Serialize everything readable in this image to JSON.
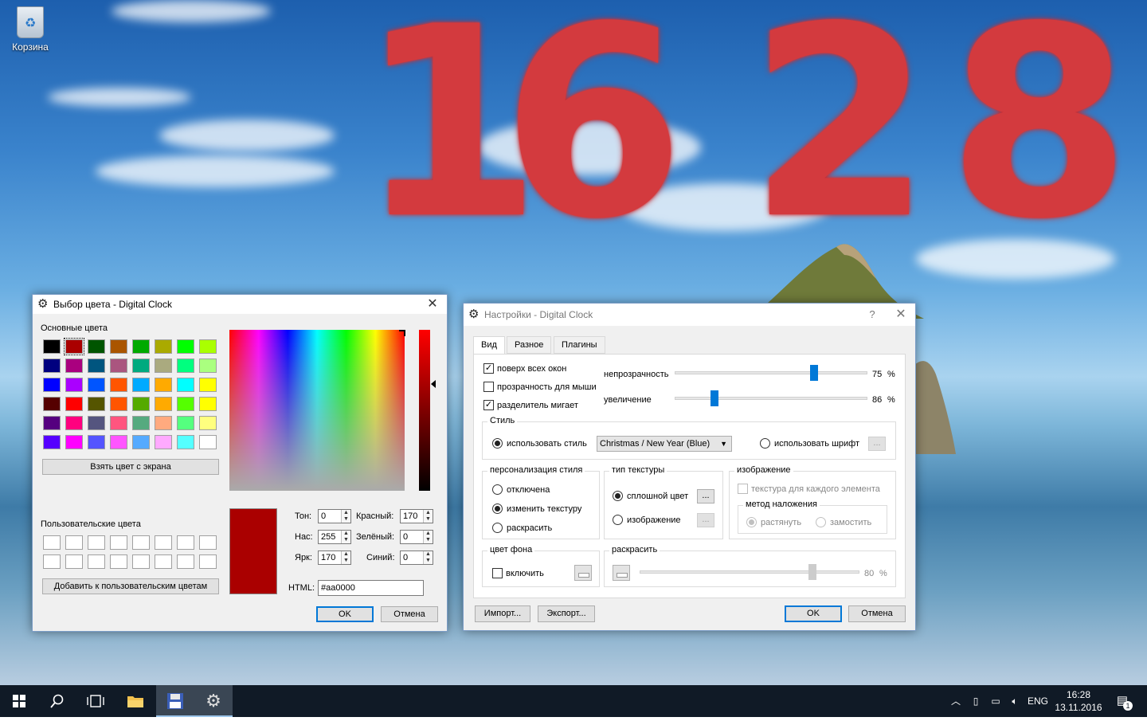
{
  "desktop": {
    "clock_digits": [
      "1",
      "6",
      "2",
      "8"
    ],
    "recycle_bin_label": "Корзина"
  },
  "color_dialog": {
    "title": "Выбор цвета - Digital Clock",
    "basic_colors_label": "Основные цвета",
    "basic_colors": [
      "#000000",
      "#aa0000",
      "#005500",
      "#aa5500",
      "#00aa00",
      "#aaaa00",
      "#00ff00",
      "#aaff00",
      "#00007f",
      "#aa007f",
      "#00557f",
      "#aa557f",
      "#00aa7f",
      "#aaaa7f",
      "#00ff7f",
      "#aaff7f",
      "#0000ff",
      "#aa00ff",
      "#0055ff",
      "#ff5500",
      "#00aaff",
      "#ffaa00",
      "#00ffff",
      "#ffff00",
      "#550000",
      "#ff0000",
      "#555500",
      "#ff5500",
      "#55aa00",
      "#ffaa00",
      "#55ff00",
      "#ffff00",
      "#55007f",
      "#ff007f",
      "#55557f",
      "#ff557f",
      "#55aa7f",
      "#ffaa7f",
      "#55ff7f",
      "#ffff7f",
      "#5500ff",
      "#ff00ff",
      "#5555ff",
      "#ff55ff",
      "#55aaff",
      "#ffaaff",
      "#55ffff",
      "#ffffff"
    ],
    "pick_screen_button": "Взять цвет с экрана",
    "custom_colors_label": "Пользовательские цвета",
    "add_custom_button": "Добавить к пользовательским цветам",
    "current_color": "#aa0000",
    "hue_label": "Тон:",
    "hue_value": "0",
    "sat_label": "Нас:",
    "sat_value": "255",
    "val_label": "Ярк:",
    "val_value": "170",
    "red_label": "Красный:",
    "red_value": "170",
    "green_label": "Зелёный:",
    "green_value": "0",
    "blue_label": "Синий:",
    "blue_value": "0",
    "html_label": "HTML:",
    "html_value": "#aa0000",
    "ok_button": "OK",
    "cancel_button": "Отмена"
  },
  "settings_dialog": {
    "title": "Настройки - Digital Clock",
    "help_glyph": "?",
    "tabs": [
      "Вид",
      "Разное",
      "Плагины"
    ],
    "stay_on_top": "поверх всех окон",
    "mouse_transparent": "прозрачность для мыши",
    "separator_blink": "разделитель мигает",
    "opacity_label": "непрозрачность",
    "opacity_value": "75",
    "zoom_label": "увеличение",
    "zoom_value": "86",
    "percent": "%",
    "style_group": "Стиль",
    "use_style": "использовать стиль",
    "style_selected": "Christmas / New Year (Blue)",
    "use_font": "использовать шрифт",
    "dots": "...",
    "personalize_group": "персонализация стиля",
    "opt_disabled": "отключена",
    "opt_change_texture": "изменить текстуру",
    "opt_colorize": "раскрасить",
    "texture_type_group": "тип текстуры",
    "solid_color": "сплошной цвет",
    "image_option": "изображение",
    "image_group": "изображение",
    "texture_per_element": "текстура для каждого элемента",
    "placement_group": "метод наложения",
    "stretch": "растянуть",
    "tile": "замостить",
    "background_group": "цвет фона",
    "enable": "включить",
    "colorize_group": "раскрасить",
    "colorize_value": "80",
    "import_button": "Импорт...",
    "export_button": "Экспорт...",
    "ok_button": "OK",
    "cancel_button": "Отмена"
  },
  "taskbar": {
    "language": "ENG",
    "time": "16:28",
    "date": "13.11.2016",
    "notification_count": "1"
  },
  "colors": {
    "accent": "#0078d7",
    "clock_red": "#d33a3e",
    "taskbar": "#101a26"
  }
}
